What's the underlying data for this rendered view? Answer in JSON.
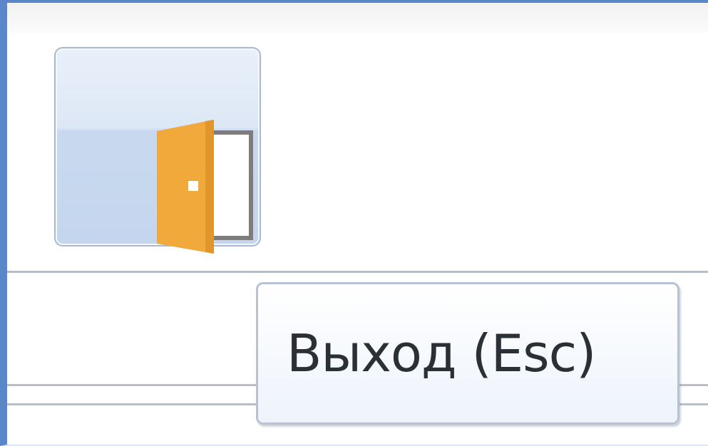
{
  "toolbar": {
    "exit_button": {
      "icon": "door-exit-icon"
    }
  },
  "tooltip": {
    "text": "Выход (Esc)"
  },
  "colors": {
    "window_border": "#5b86c8",
    "button_background": "#c8d9ef",
    "door_orange": "#f0a93a",
    "door_frame": "#7d7d7d"
  }
}
